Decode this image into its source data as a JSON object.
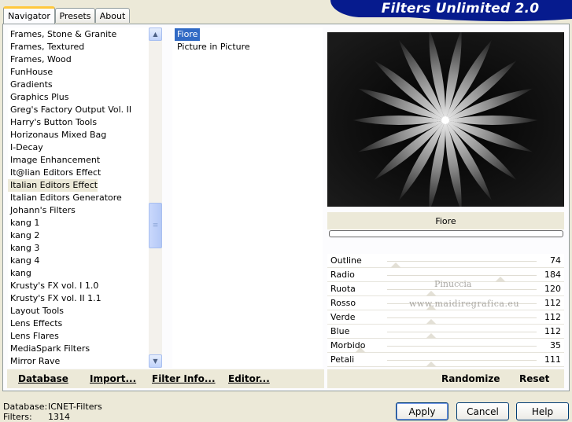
{
  "tabs": [
    {
      "label": "Navigator",
      "active": true
    },
    {
      "label": "Presets",
      "active": false
    },
    {
      "label": "About",
      "active": false
    }
  ],
  "banner_title": "Filters Unlimited 2.0",
  "categories": [
    "Frames, Stone & Granite",
    "Frames, Textured",
    "Frames, Wood",
    "FunHouse",
    "Gradients",
    "Graphics Plus",
    "Greg's Factory Output Vol. II",
    "Harry's Button Tools",
    "Horizonaus Mixed Bag",
    "I-Decay",
    "Image Enhancement",
    "It@lian Editors Effect",
    "Italian Editors Effect",
    "Italian Editors Generatore",
    "Johann's Filters",
    "kang 1",
    "kang 2",
    "kang 3",
    "kang 4",
    "kang",
    "Krusty's FX vol. I 1.0",
    "Krusty's FX vol. II 1.1",
    "Layout Tools",
    "Lens Effects",
    "Lens Flares",
    "MediaSpark Filters",
    "Mirror Rave"
  ],
  "selected_category": "Italian Editors Effect",
  "filters": [
    "Fiore",
    "Picture in Picture"
  ],
  "selected_filter": "Fiore",
  "left_buttons": {
    "database": "Database",
    "import": "Import...",
    "filter_info": "Filter Info...",
    "editor": "Editor..."
  },
  "preview_name": "Fiore",
  "parameters": [
    {
      "label": "Outline",
      "value": "74"
    },
    {
      "label": "Radio",
      "value": "184"
    },
    {
      "label": "Ruota",
      "value": "120"
    },
    {
      "label": "Rosso",
      "value": "112"
    },
    {
      "label": "Verde",
      "value": "112"
    },
    {
      "label": "Blue",
      "value": "112"
    },
    {
      "label": "Morbido",
      "value": "35"
    },
    {
      "label": "Petali",
      "value": "111"
    }
  ],
  "watermark": {
    "line1": "Pinuccia",
    "line2": "www.maidiregrafica.eu"
  },
  "right_buttons": {
    "randomize": "Randomize",
    "reset": "Reset"
  },
  "footer": {
    "database_label": "Database:",
    "database_value": "ICNET-Filters",
    "filters_label": "Filters:",
    "filters_value": "1314"
  },
  "dialog_buttons": {
    "apply": "Apply",
    "cancel": "Cancel",
    "help": "Help"
  },
  "colors": {
    "accent": "#316ac5",
    "banner": "#061b8e",
    "tab_highlight": "#ffc83c"
  }
}
